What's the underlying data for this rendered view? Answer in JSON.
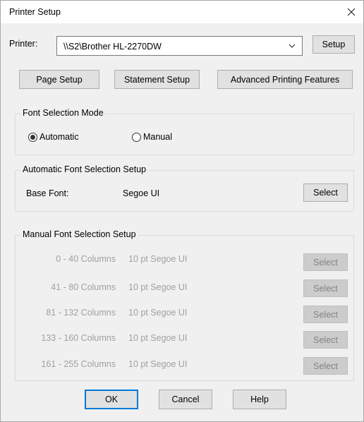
{
  "window": {
    "title": "Printer Setup",
    "close_icon": "close-icon"
  },
  "printer": {
    "label": "Printer:",
    "value": "\\\\S2\\Brother HL-2270DW",
    "setup_button": "Setup"
  },
  "buttons": {
    "page_setup": "Page Setup",
    "statement_setup": "Statement Setup",
    "advanced": "Advanced Printing Features",
    "ok": "OK",
    "cancel": "Cancel",
    "help": "Help"
  },
  "font_mode": {
    "title": "Font Selection Mode",
    "automatic": "Automatic",
    "manual": "Manual",
    "selected": "automatic"
  },
  "auto_setup": {
    "title": "Automatic Font Selection Setup",
    "base_font_label": "Base Font:",
    "base_font_value": "Segoe UI",
    "select_button": "Select"
  },
  "manual_setup": {
    "title": "Manual Font Selection Setup",
    "rows": [
      {
        "columns": "0 - 40 Columns",
        "font": "10 pt Segoe UI",
        "button": "Select"
      },
      {
        "columns": "41 - 80 Columns",
        "font": "10 pt Segoe UI",
        "button": "Select"
      },
      {
        "columns": "81 - 132 Columns",
        "font": "10 pt Segoe UI",
        "button": "Select"
      },
      {
        "columns": "133 - 160 Columns",
        "font": "10 pt Segoe UI",
        "button": "Select"
      },
      {
        "columns": "161 - 255 Columns",
        "font": "10 pt Segoe UI",
        "button": "Select"
      }
    ]
  },
  "colors": {
    "accent": "#0078d7",
    "dialog_bg": "#f0f0f0",
    "disabled_text": "#a0a0a0"
  }
}
